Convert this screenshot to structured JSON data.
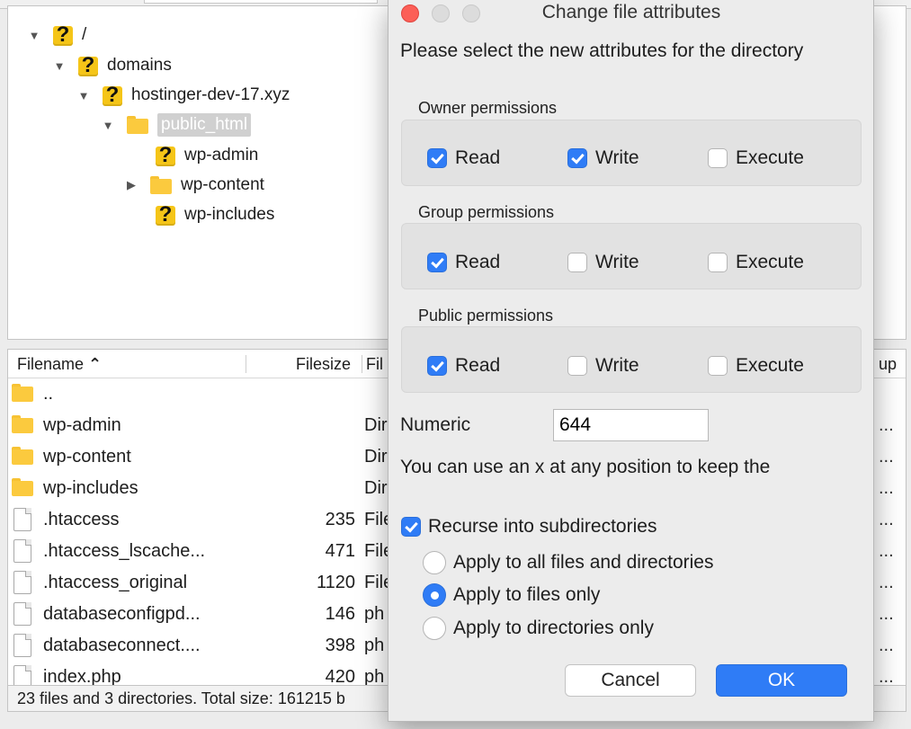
{
  "tree": {
    "nodes": [
      {
        "label": "/",
        "icon": "question-icon",
        "expanded": true
      },
      {
        "label": "domains",
        "icon": "question-icon",
        "expanded": true
      },
      {
        "label": "hostinger-dev-17.xyz",
        "icon": "question-icon",
        "expanded": true
      },
      {
        "label": "public_html",
        "icon": "folder-icon",
        "expanded": true,
        "selected": true
      },
      {
        "label": "wp-admin",
        "icon": "question-icon"
      },
      {
        "label": "wp-content",
        "icon": "folder-icon",
        "expanded": false
      },
      {
        "label": "wp-includes",
        "icon": "question-icon"
      }
    ]
  },
  "filelist": {
    "headers": {
      "filename": "Filename",
      "sort_glyph": "⌃",
      "filesize": "Filesize",
      "filetype": "Fil",
      "group": "up"
    },
    "rows": [
      {
        "name": "..",
        "size": "",
        "type": "",
        "icon": "folder-icon"
      },
      {
        "name": "wp-admin",
        "size": "",
        "type": "Dir",
        "icon": "folder-icon"
      },
      {
        "name": "wp-content",
        "size": "",
        "type": "Dir",
        "icon": "folder-icon"
      },
      {
        "name": "wp-includes",
        "size": "",
        "type": "Dir",
        "icon": "folder-icon"
      },
      {
        "name": ".htaccess",
        "size": "235",
        "type": "File",
        "icon": "file-icon"
      },
      {
        "name": ".htaccess_lscache...",
        "size": "471",
        "type": "File",
        "icon": "file-icon"
      },
      {
        "name": ".htaccess_original",
        "size": "1120",
        "type": "File",
        "icon": "file-icon"
      },
      {
        "name": "databaseconfigpd...",
        "size": "146",
        "type": "ph",
        "icon": "file-icon"
      },
      {
        "name": "databaseconnect....",
        "size": "398",
        "type": "ph",
        "icon": "file-icon"
      },
      {
        "name": "index.php",
        "size": "420",
        "type": "ph",
        "icon": "file-icon"
      }
    ],
    "truncation": "..."
  },
  "status": {
    "text": "23 files and 3 directories. Total size: 161215 b"
  },
  "dialog": {
    "title": "Change file attributes",
    "intro": "Please select the new attributes for the directory",
    "groups": [
      {
        "label": "Owner permissions",
        "read": {
          "label": "Read",
          "checked": true
        },
        "write": {
          "label": "Write",
          "checked": true
        },
        "execute": {
          "label": "Execute",
          "checked": false
        }
      },
      {
        "label": "Group permissions",
        "read": {
          "label": "Read",
          "checked": true
        },
        "write": {
          "label": "Write",
          "checked": false
        },
        "execute": {
          "label": "Execute",
          "checked": false
        }
      },
      {
        "label": "Public permissions",
        "read": {
          "label": "Read",
          "checked": true
        },
        "write": {
          "label": "Write",
          "checked": false
        },
        "execute": {
          "label": "Execute",
          "checked": false
        }
      }
    ],
    "numeric_label": "Numeric",
    "numeric_value": "644",
    "hint": "You can use an x at any position to keep the",
    "recurse": {
      "label": "Recurse into subdirectories",
      "checked": true
    },
    "apply_options": [
      {
        "label": "Apply to all files and directories",
        "selected": false
      },
      {
        "label": "Apply to files only",
        "selected": true
      },
      {
        "label": "Apply to directories only",
        "selected": false
      }
    ],
    "cancel_label": "Cancel",
    "ok_label": "OK"
  },
  "colors": {
    "accent": "#2f7cf6",
    "folder": "#fbca3e",
    "question": "#f5c518",
    "close": "#fc5f57"
  }
}
